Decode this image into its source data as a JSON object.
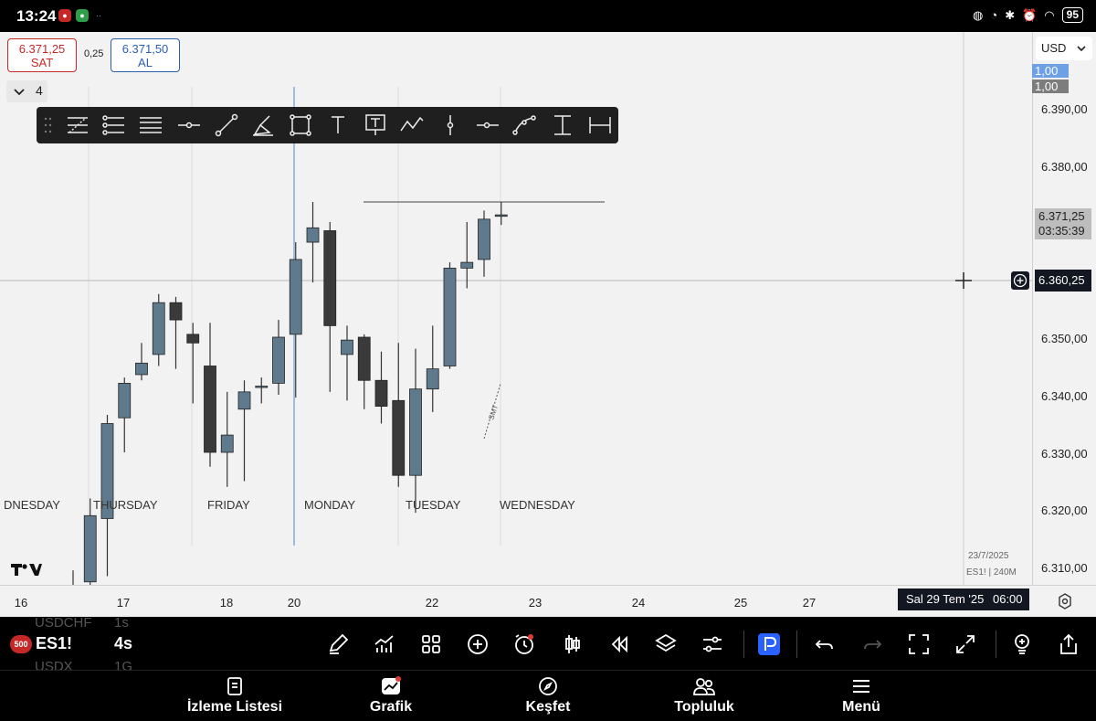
{
  "status_bar": {
    "time": "13:24",
    "battery": "95"
  },
  "trade": {
    "sell_price": "6.371,25",
    "sell_label": "SAT",
    "spread": "0,25",
    "buy_price": "6.371,50",
    "buy_label": "AL"
  },
  "interval": {
    "value": "4"
  },
  "currency": "USD",
  "price_axis": {
    "labels": [
      "6.390,00",
      "6.380,00",
      "6.350,00",
      "6.340,00",
      "6.330,00",
      "6.320,00",
      "6.310,00"
    ],
    "tag_top": "1,00",
    "tag_bottom": "1,00",
    "current_price": "6.371,25",
    "countdown": "03:35:39",
    "crosshair_price": "6.360,25"
  },
  "time_axis": {
    "labels": [
      "16",
      "17",
      "18",
      "20",
      "22",
      "23",
      "24",
      "25",
      "27"
    ],
    "crosshair_date": "Sal 29 Tem '25",
    "crosshair_time": "06:00"
  },
  "day_labels": [
    "DNESDAY",
    "THURSDAY",
    "FRIDAY",
    "MONDAY",
    "TUESDAY",
    "WEDNESDAY"
  ],
  "annotation": "SMT",
  "watermark": {
    "date": "23/7/2025",
    "symbol": "ES1! | 240M"
  },
  "colors": {
    "bull": "#5f7a8c",
    "bear": "#3a3a3a",
    "sell": "#c62828",
    "buy": "#2b5fb0"
  },
  "chart_data": {
    "type": "candlestick",
    "candles": [
      {
        "o": 6305.0,
        "h": 6309.5,
        "l": 6298.0,
        "c": 6305.5
      },
      {
        "o": 6307.5,
        "h": 6322.0,
        "l": 6300.0,
        "c": 6319.0
      },
      {
        "o": 6318.5,
        "h": 6336.5,
        "l": 6308.5,
        "c": 6335.0
      },
      {
        "o": 6336.0,
        "h": 6343.0,
        "l": 6330.0,
        "c": 6342.0
      },
      {
        "o": 6343.5,
        "h": 6349.0,
        "l": 6342.5,
        "c": 6345.5
      },
      {
        "o": 6347.0,
        "h": 6357.5,
        "l": 6345.0,
        "c": 6356.0
      },
      {
        "o": 6356.0,
        "h": 6357.0,
        "l": 6344.5,
        "c": 6353.0
      },
      {
        "o": 6350.5,
        "h": 6352.5,
        "l": 6338.5,
        "c": 6349.0
      },
      {
        "o": 6345.0,
        "h": 6352.5,
        "l": 6327.5,
        "c": 6330.0
      },
      {
        "o": 6330.0,
        "h": 6340.5,
        "l": 6324.0,
        "c": 6333.0
      },
      {
        "o": 6337.5,
        "h": 6342.5,
        "l": 6325.0,
        "c": 6340.5
      },
      {
        "o": 6341.5,
        "h": 6343.0,
        "l": 6338.5,
        "c": 6341.5
      },
      {
        "o": 6342.0,
        "h": 6353.0,
        "l": 6340.0,
        "c": 6350.0
      },
      {
        "o": 6350.5,
        "h": 6366.5,
        "l": 6339.5,
        "c": 6363.5
      },
      {
        "o": 6366.5,
        "h": 6373.5,
        "l": 6359.5,
        "c": 6369.0
      },
      {
        "o": 6368.5,
        "h": 6370.0,
        "l": 6340.5,
        "c": 6352.0
      },
      {
        "o": 6347.0,
        "h": 6352.0,
        "l": 6339.0,
        "c": 6349.5
      },
      {
        "o": 6350.0,
        "h": 6350.5,
        "l": 6337.5,
        "c": 6342.5
      },
      {
        "o": 6342.5,
        "h": 6347.5,
        "l": 6335.0,
        "c": 6338.0
      },
      {
        "o": 6339.0,
        "h": 6349.0,
        "l": 6324.0,
        "c": 6326.0
      },
      {
        "o": 6326.0,
        "h": 6348.0,
        "l": 6319.5,
        "c": 6341.0
      },
      {
        "o": 6341.0,
        "h": 6352.0,
        "l": 6337.0,
        "c": 6344.5
      },
      {
        "o": 6345.0,
        "h": 6363.0,
        "l": 6344.5,
        "c": 6362.0
      },
      {
        "o": 6362.0,
        "h": 6370.0,
        "l": 6358.5,
        "c": 6363.0
      },
      {
        "o": 6363.5,
        "h": 6372.0,
        "l": 6360.5,
        "c": 6370.5
      },
      {
        "o": 6371.0,
        "h": 6373.5,
        "l": 6369.5,
        "c": 6371.25
      }
    ],
    "x_ticks": [
      "16",
      "17",
      "18",
      "20",
      "22",
      "23",
      "24",
      "25",
      "27"
    ],
    "horizontal_line": 6373.5,
    "y_range": [
      6305,
      6395
    ]
  },
  "bottom_toolbar": {
    "symbol": "ES1!",
    "interval": "4s",
    "badge": "500",
    "ghost_symbol_top": "USDCHF",
    "ghost_interval_top": "1s",
    "ghost_symbol_bottom": "USDX",
    "ghost_interval_bottom": "1G"
  },
  "nav": {
    "watchlist": "İzleme Listesi",
    "chart": "Grafik",
    "explore": "Keşfet",
    "community": "Topluluk",
    "menu": "Menü"
  }
}
